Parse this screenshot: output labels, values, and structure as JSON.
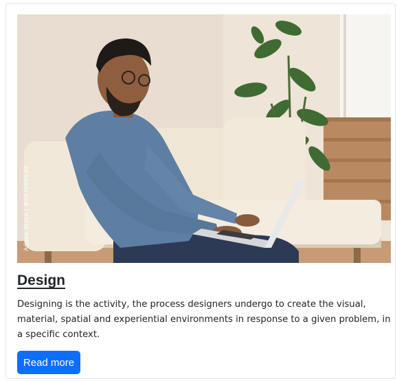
{
  "card": {
    "image": {
      "alt": "Man with glasses using a laptop on a sofa",
      "watermark": "Adobe Stock | #297068539"
    },
    "title": "Design",
    "text": "Designing is the activity, the process designers undergo to create the visual, material, spatial and experiential environments in response to a given problem, in a specific context.",
    "button_label": "Read more"
  },
  "colors": {
    "primary": "#0d6efd",
    "text": "#212529"
  }
}
